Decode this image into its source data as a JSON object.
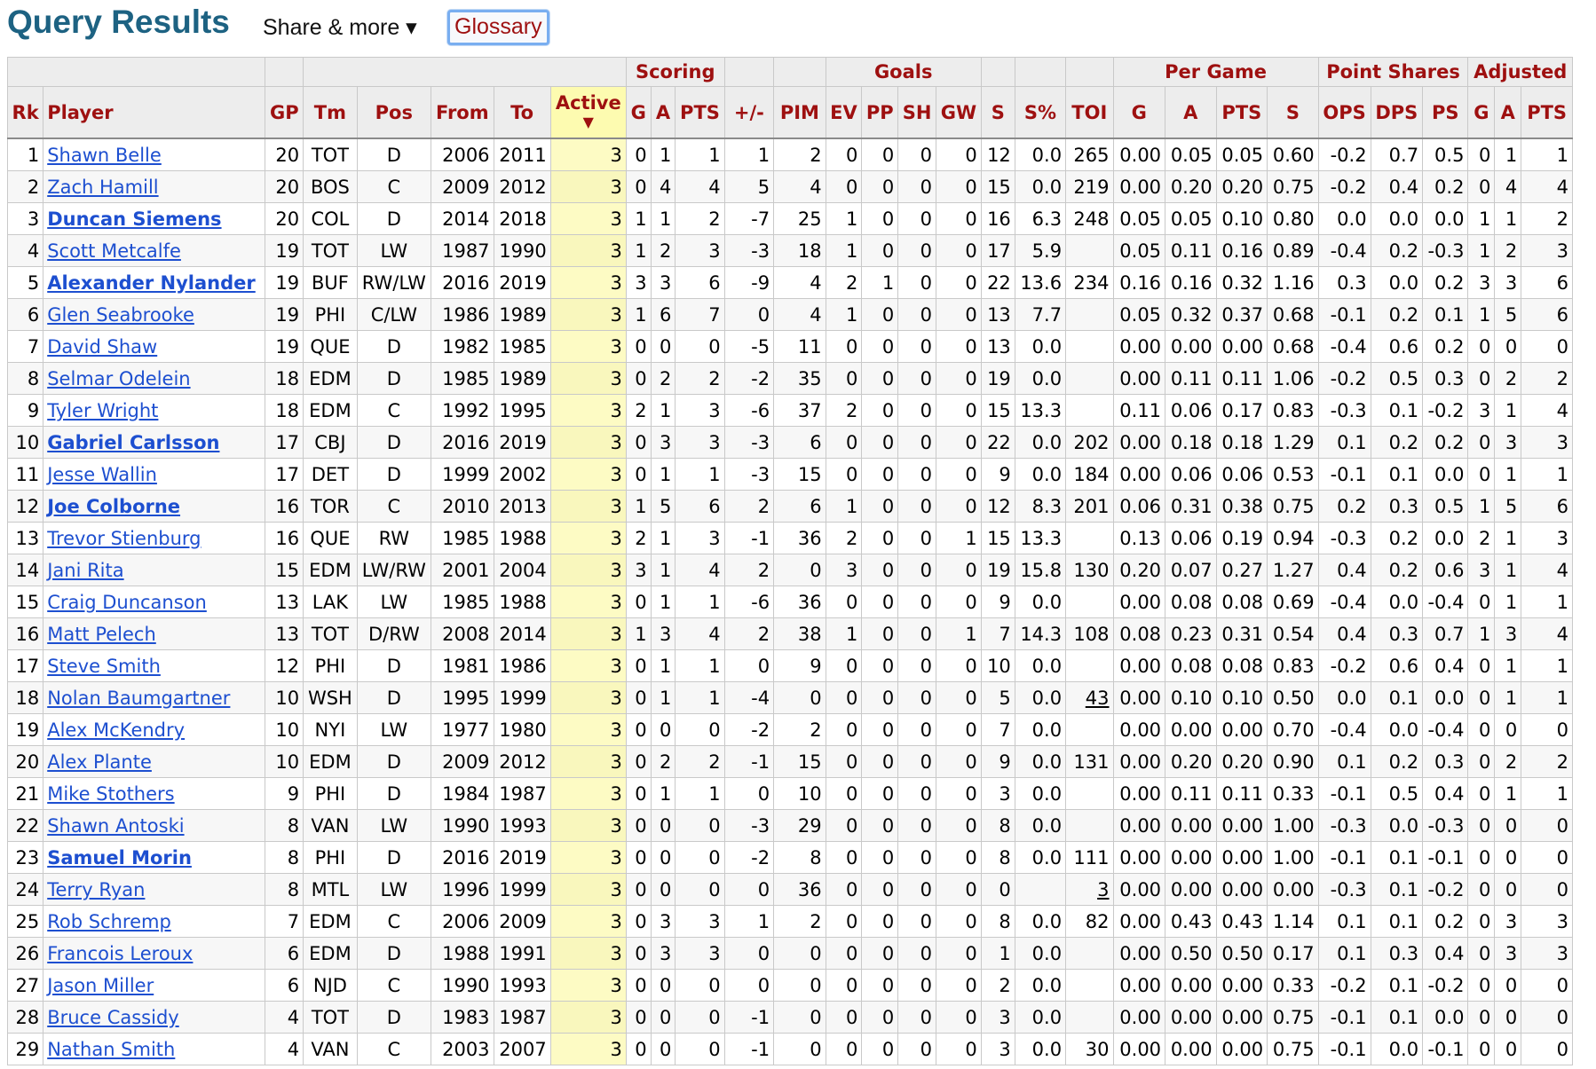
{
  "page": {
    "title": "Query Results",
    "share_label": "Share & more ▾",
    "glossary_label": "Glossary"
  },
  "groups": {
    "scoring": "Scoring",
    "goals": "Goals",
    "per_game": "Per Game",
    "point_shares": "Point Shares",
    "adjusted": "Adjusted"
  },
  "columns": [
    "Rk",
    "Player",
    "GP",
    "Tm",
    "Pos",
    "From",
    "To",
    "Active",
    "G",
    "A",
    "PTS",
    "+/-",
    "PIM",
    "EV",
    "PP",
    "SH",
    "GW",
    "S",
    "S%",
    "TOI",
    "G",
    "A",
    "PTS",
    "S",
    "OPS",
    "DPS",
    "PS",
    "G",
    "A",
    "PTS"
  ],
  "sort_indicator": "▼",
  "rows": [
    {
      "cells": [
        "1",
        "Shawn Belle",
        "20",
        "TOT",
        "D",
        "2006",
        "2011",
        "3",
        "0",
        "1",
        "1",
        "1",
        "2",
        "0",
        "0",
        "0",
        "0",
        "12",
        "0.0",
        "265",
        "0.00",
        "0.05",
        "0.05",
        "0.60",
        "-0.2",
        "0.7",
        "0.5",
        "0",
        "1",
        "1"
      ],
      "bold": false,
      "toi_link": false
    },
    {
      "cells": [
        "2",
        "Zach Hamill",
        "20",
        "BOS",
        "C",
        "2009",
        "2012",
        "3",
        "0",
        "4",
        "4",
        "5",
        "4",
        "0",
        "0",
        "0",
        "0",
        "15",
        "0.0",
        "219",
        "0.00",
        "0.20",
        "0.20",
        "0.75",
        "-0.2",
        "0.4",
        "0.2",
        "0",
        "4",
        "4"
      ],
      "bold": false,
      "toi_link": false
    },
    {
      "cells": [
        "3",
        "Duncan Siemens",
        "20",
        "COL",
        "D",
        "2014",
        "2018",
        "3",
        "1",
        "1",
        "2",
        "-7",
        "25",
        "1",
        "0",
        "0",
        "0",
        "16",
        "6.3",
        "248",
        "0.05",
        "0.05",
        "0.10",
        "0.80",
        "0.0",
        "0.0",
        "0.0",
        "1",
        "1",
        "2"
      ],
      "bold": true,
      "toi_link": false
    },
    {
      "cells": [
        "4",
        "Scott Metcalfe",
        "19",
        "TOT",
        "LW",
        "1987",
        "1990",
        "3",
        "1",
        "2",
        "3",
        "-3",
        "18",
        "1",
        "0",
        "0",
        "0",
        "17",
        "5.9",
        "",
        "0.05",
        "0.11",
        "0.16",
        "0.89",
        "-0.4",
        "0.2",
        "-0.3",
        "1",
        "2",
        "3"
      ],
      "bold": false,
      "toi_link": false
    },
    {
      "cells": [
        "5",
        "Alexander Nylander",
        "19",
        "BUF",
        "RW/LW",
        "2016",
        "2019",
        "3",
        "3",
        "3",
        "6",
        "-9",
        "4",
        "2",
        "1",
        "0",
        "0",
        "22",
        "13.6",
        "234",
        "0.16",
        "0.16",
        "0.32",
        "1.16",
        "0.3",
        "0.0",
        "0.2",
        "3",
        "3",
        "6"
      ],
      "bold": true,
      "toi_link": false
    },
    {
      "cells": [
        "6",
        "Glen Seabrooke",
        "19",
        "PHI",
        "C/LW",
        "1986",
        "1989",
        "3",
        "1",
        "6",
        "7",
        "0",
        "4",
        "1",
        "0",
        "0",
        "0",
        "13",
        "7.7",
        "",
        "0.05",
        "0.32",
        "0.37",
        "0.68",
        "-0.1",
        "0.2",
        "0.1",
        "1",
        "5",
        "6"
      ],
      "bold": false,
      "toi_link": false
    },
    {
      "cells": [
        "7",
        "David Shaw",
        "19",
        "QUE",
        "D",
        "1982",
        "1985",
        "3",
        "0",
        "0",
        "0",
        "-5",
        "11",
        "0",
        "0",
        "0",
        "0",
        "13",
        "0.0",
        "",
        "0.00",
        "0.00",
        "0.00",
        "0.68",
        "-0.4",
        "0.6",
        "0.2",
        "0",
        "0",
        "0"
      ],
      "bold": false,
      "toi_link": false
    },
    {
      "cells": [
        "8",
        "Selmar Odelein",
        "18",
        "EDM",
        "D",
        "1985",
        "1989",
        "3",
        "0",
        "2",
        "2",
        "-2",
        "35",
        "0",
        "0",
        "0",
        "0",
        "19",
        "0.0",
        "",
        "0.00",
        "0.11",
        "0.11",
        "1.06",
        "-0.2",
        "0.5",
        "0.3",
        "0",
        "2",
        "2"
      ],
      "bold": false,
      "toi_link": false
    },
    {
      "cells": [
        "9",
        "Tyler Wright",
        "18",
        "EDM",
        "C",
        "1992",
        "1995",
        "3",
        "2",
        "1",
        "3",
        "-6",
        "37",
        "2",
        "0",
        "0",
        "0",
        "15",
        "13.3",
        "",
        "0.11",
        "0.06",
        "0.17",
        "0.83",
        "-0.3",
        "0.1",
        "-0.2",
        "3",
        "1",
        "4"
      ],
      "bold": false,
      "toi_link": false
    },
    {
      "cells": [
        "10",
        "Gabriel Carlsson",
        "17",
        "CBJ",
        "D",
        "2016",
        "2019",
        "3",
        "0",
        "3",
        "3",
        "-3",
        "6",
        "0",
        "0",
        "0",
        "0",
        "22",
        "0.0",
        "202",
        "0.00",
        "0.18",
        "0.18",
        "1.29",
        "0.1",
        "0.2",
        "0.2",
        "0",
        "3",
        "3"
      ],
      "bold": true,
      "toi_link": false
    },
    {
      "cells": [
        "11",
        "Jesse Wallin",
        "17",
        "DET",
        "D",
        "1999",
        "2002",
        "3",
        "0",
        "1",
        "1",
        "-3",
        "15",
        "0",
        "0",
        "0",
        "0",
        "9",
        "0.0",
        "184",
        "0.00",
        "0.06",
        "0.06",
        "0.53",
        "-0.1",
        "0.1",
        "0.0",
        "0",
        "1",
        "1"
      ],
      "bold": false,
      "toi_link": false
    },
    {
      "cells": [
        "12",
        "Joe Colborne",
        "16",
        "TOR",
        "C",
        "2010",
        "2013",
        "3",
        "1",
        "5",
        "6",
        "2",
        "6",
        "1",
        "0",
        "0",
        "0",
        "12",
        "8.3",
        "201",
        "0.06",
        "0.31",
        "0.38",
        "0.75",
        "0.2",
        "0.3",
        "0.5",
        "1",
        "5",
        "6"
      ],
      "bold": true,
      "toi_link": false
    },
    {
      "cells": [
        "13",
        "Trevor Stienburg",
        "16",
        "QUE",
        "RW",
        "1985",
        "1988",
        "3",
        "2",
        "1",
        "3",
        "-1",
        "36",
        "2",
        "0",
        "0",
        "1",
        "15",
        "13.3",
        "",
        "0.13",
        "0.06",
        "0.19",
        "0.94",
        "-0.3",
        "0.2",
        "0.0",
        "2",
        "1",
        "3"
      ],
      "bold": false,
      "toi_link": false
    },
    {
      "cells": [
        "14",
        "Jani Rita",
        "15",
        "EDM",
        "LW/RW",
        "2001",
        "2004",
        "3",
        "3",
        "1",
        "4",
        "2",
        "0",
        "3",
        "0",
        "0",
        "0",
        "19",
        "15.8",
        "130",
        "0.20",
        "0.07",
        "0.27",
        "1.27",
        "0.4",
        "0.2",
        "0.6",
        "3",
        "1",
        "4"
      ],
      "bold": false,
      "toi_link": false
    },
    {
      "cells": [
        "15",
        "Craig Duncanson",
        "13",
        "LAK",
        "LW",
        "1985",
        "1988",
        "3",
        "0",
        "1",
        "1",
        "-6",
        "36",
        "0",
        "0",
        "0",
        "0",
        "9",
        "0.0",
        "",
        "0.00",
        "0.08",
        "0.08",
        "0.69",
        "-0.4",
        "0.0",
        "-0.4",
        "0",
        "1",
        "1"
      ],
      "bold": false,
      "toi_link": false
    },
    {
      "cells": [
        "16",
        "Matt Pelech",
        "13",
        "TOT",
        "D/RW",
        "2008",
        "2014",
        "3",
        "1",
        "3",
        "4",
        "2",
        "38",
        "1",
        "0",
        "0",
        "1",
        "7",
        "14.3",
        "108",
        "0.08",
        "0.23",
        "0.31",
        "0.54",
        "0.4",
        "0.3",
        "0.7",
        "1",
        "3",
        "4"
      ],
      "bold": false,
      "toi_link": false
    },
    {
      "cells": [
        "17",
        "Steve Smith",
        "12",
        "PHI",
        "D",
        "1981",
        "1986",
        "3",
        "0",
        "1",
        "1",
        "0",
        "9",
        "0",
        "0",
        "0",
        "0",
        "10",
        "0.0",
        "",
        "0.00",
        "0.08",
        "0.08",
        "0.83",
        "-0.2",
        "0.6",
        "0.4",
        "0",
        "1",
        "1"
      ],
      "bold": false,
      "toi_link": false
    },
    {
      "cells": [
        "18",
        "Nolan Baumgartner",
        "10",
        "WSH",
        "D",
        "1995",
        "1999",
        "3",
        "0",
        "1",
        "1",
        "-4",
        "0",
        "0",
        "0",
        "0",
        "0",
        "5",
        "0.0",
        "43",
        "0.00",
        "0.10",
        "0.10",
        "0.50",
        "0.0",
        "0.1",
        "0.0",
        "0",
        "1",
        "1"
      ],
      "bold": false,
      "toi_link": true
    },
    {
      "cells": [
        "19",
        "Alex McKendry",
        "10",
        "NYI",
        "LW",
        "1977",
        "1980",
        "3",
        "0",
        "0",
        "0",
        "-2",
        "2",
        "0",
        "0",
        "0",
        "0",
        "7",
        "0.0",
        "",
        "0.00",
        "0.00",
        "0.00",
        "0.70",
        "-0.4",
        "0.0",
        "-0.4",
        "0",
        "0",
        "0"
      ],
      "bold": false,
      "toi_link": false
    },
    {
      "cells": [
        "20",
        "Alex Plante",
        "10",
        "EDM",
        "D",
        "2009",
        "2012",
        "3",
        "0",
        "2",
        "2",
        "-1",
        "15",
        "0",
        "0",
        "0",
        "0",
        "9",
        "0.0",
        "131",
        "0.00",
        "0.20",
        "0.20",
        "0.90",
        "0.1",
        "0.2",
        "0.3",
        "0",
        "2",
        "2"
      ],
      "bold": false,
      "toi_link": false
    },
    {
      "cells": [
        "21",
        "Mike Stothers",
        "9",
        "PHI",
        "D",
        "1984",
        "1987",
        "3",
        "0",
        "1",
        "1",
        "0",
        "10",
        "0",
        "0",
        "0",
        "0",
        "3",
        "0.0",
        "",
        "0.00",
        "0.11",
        "0.11",
        "0.33",
        "-0.1",
        "0.5",
        "0.4",
        "0",
        "1",
        "1"
      ],
      "bold": false,
      "toi_link": false
    },
    {
      "cells": [
        "22",
        "Shawn Antoski",
        "8",
        "VAN",
        "LW",
        "1990",
        "1993",
        "3",
        "0",
        "0",
        "0",
        "-3",
        "29",
        "0",
        "0",
        "0",
        "0",
        "8",
        "0.0",
        "",
        "0.00",
        "0.00",
        "0.00",
        "1.00",
        "-0.3",
        "0.0",
        "-0.3",
        "0",
        "0",
        "0"
      ],
      "bold": false,
      "toi_link": false
    },
    {
      "cells": [
        "23",
        "Samuel Morin",
        "8",
        "PHI",
        "D",
        "2016",
        "2019",
        "3",
        "0",
        "0",
        "0",
        "-2",
        "8",
        "0",
        "0",
        "0",
        "0",
        "8",
        "0.0",
        "111",
        "0.00",
        "0.00",
        "0.00",
        "1.00",
        "-0.1",
        "0.1",
        "-0.1",
        "0",
        "0",
        "0"
      ],
      "bold": true,
      "toi_link": false
    },
    {
      "cells": [
        "24",
        "Terry Ryan",
        "8",
        "MTL",
        "LW",
        "1996",
        "1999",
        "3",
        "0",
        "0",
        "0",
        "0",
        "36",
        "0",
        "0",
        "0",
        "0",
        "0",
        "",
        "3",
        "0.00",
        "0.00",
        "0.00",
        "0.00",
        "-0.3",
        "0.1",
        "-0.2",
        "0",
        "0",
        "0"
      ],
      "bold": false,
      "toi_link": true
    },
    {
      "cells": [
        "25",
        "Rob Schremp",
        "7",
        "EDM",
        "C",
        "2006",
        "2009",
        "3",
        "0",
        "3",
        "3",
        "1",
        "2",
        "0",
        "0",
        "0",
        "0",
        "8",
        "0.0",
        "82",
        "0.00",
        "0.43",
        "0.43",
        "1.14",
        "0.1",
        "0.1",
        "0.2",
        "0",
        "3",
        "3"
      ],
      "bold": false,
      "toi_link": false
    },
    {
      "cells": [
        "26",
        "Francois Leroux",
        "6",
        "EDM",
        "D",
        "1988",
        "1991",
        "3",
        "0",
        "3",
        "3",
        "0",
        "0",
        "0",
        "0",
        "0",
        "0",
        "1",
        "0.0",
        "",
        "0.00",
        "0.50",
        "0.50",
        "0.17",
        "0.1",
        "0.3",
        "0.4",
        "0",
        "3",
        "3"
      ],
      "bold": false,
      "toi_link": false
    },
    {
      "cells": [
        "27",
        "Jason Miller",
        "6",
        "NJD",
        "C",
        "1990",
        "1993",
        "3",
        "0",
        "0",
        "0",
        "0",
        "0",
        "0",
        "0",
        "0",
        "0",
        "2",
        "0.0",
        "",
        "0.00",
        "0.00",
        "0.00",
        "0.33",
        "-0.2",
        "0.1",
        "-0.2",
        "0",
        "0",
        "0"
      ],
      "bold": false,
      "toi_link": false
    },
    {
      "cells": [
        "28",
        "Bruce Cassidy",
        "4",
        "TOT",
        "D",
        "1983",
        "1987",
        "3",
        "0",
        "0",
        "0",
        "-1",
        "0",
        "0",
        "0",
        "0",
        "0",
        "3",
        "0.0",
        "",
        "0.00",
        "0.00",
        "0.00",
        "0.75",
        "-0.1",
        "0.1",
        "0.0",
        "0",
        "0",
        "0"
      ],
      "bold": false,
      "toi_link": false
    },
    {
      "cells": [
        "29",
        "Nathan Smith",
        "4",
        "VAN",
        "C",
        "2003",
        "2007",
        "3",
        "0",
        "0",
        "0",
        "-1",
        "0",
        "0",
        "0",
        "0",
        "0",
        "3",
        "0.0",
        "30",
        "0.00",
        "0.00",
        "0.00",
        "0.75",
        "-0.1",
        "0.0",
        "-0.1",
        "0",
        "0",
        "0"
      ],
      "bold": false,
      "toi_link": false
    }
  ]
}
